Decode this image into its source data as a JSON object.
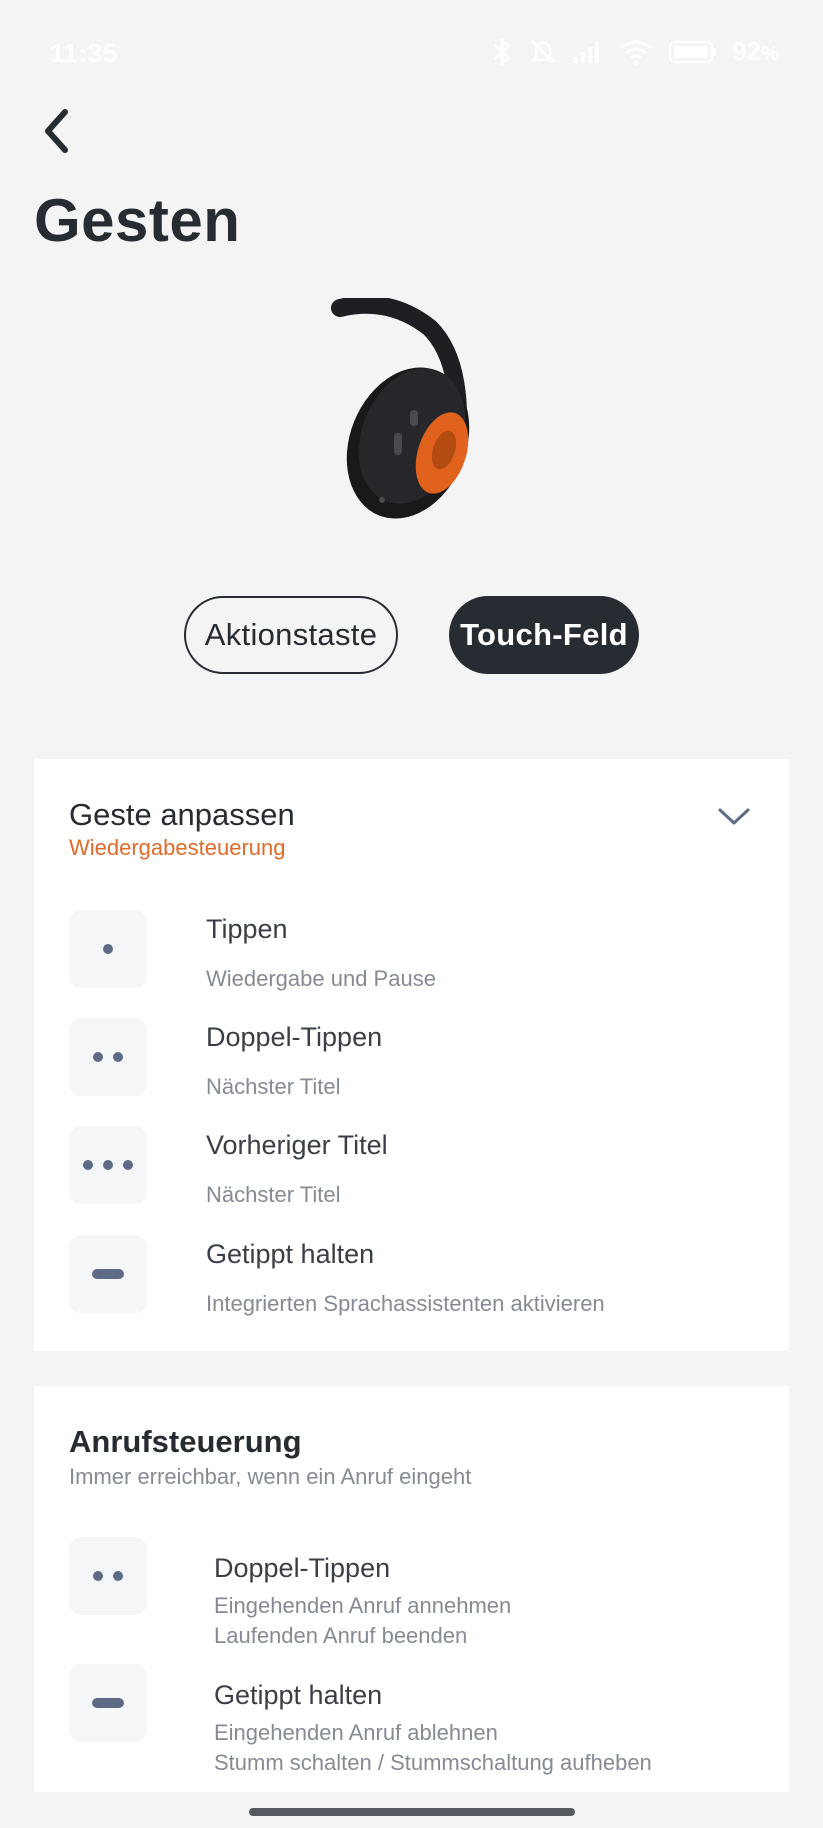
{
  "status_bar": {
    "time": "11:35",
    "battery_percent": "92",
    "icons": [
      "bluetooth-icon",
      "mute-icon",
      "signal-icon",
      "wifi-icon",
      "battery-icon"
    ]
  },
  "header": {
    "title": "Gesten"
  },
  "tabs": [
    {
      "label": "Aktionstaste",
      "active": false
    },
    {
      "label": "Touch-Feld",
      "active": true
    }
  ],
  "gesture_card": {
    "title": "Geste anpassen",
    "subtitle": "Wiedergabesteuerung",
    "items": [
      {
        "icon": "single-tap-icon",
        "label": "Tippen",
        "description": "Wiedergabe und Pause"
      },
      {
        "icon": "double-tap-icon",
        "label": "Doppel-Tippen",
        "description": "Nächster Titel"
      },
      {
        "icon": "triple-tap-icon",
        "label": "Vorheriger Titel",
        "description": "Nächster Titel"
      },
      {
        "icon": "press-hold-icon",
        "label": "Getippt halten",
        "description": "Integrierten Sprachassistenten aktivieren"
      }
    ]
  },
  "call_card": {
    "title": "Anrufsteuerung",
    "subtitle": "Immer erreichbar, wenn ein Anruf eingeht",
    "items": [
      {
        "icon": "double-tap-icon",
        "label": "Doppel-Tippen",
        "description_1": "Eingehenden Anruf annehmen",
        "description_2": "Laufenden Anruf beenden"
      },
      {
        "icon": "press-hold-icon",
        "label": "Getippt halten",
        "description_1": "Eingehenden Anruf ablehnen",
        "description_2": "Stumm schalten / Stummschaltung aufheben"
      }
    ]
  },
  "colors": {
    "background": "#f4f4f5",
    "primary_dark": "#272c33",
    "accent_orange": "#e06a2a",
    "secondary_text": "#858b95",
    "icon_dot": "#5d6b86"
  }
}
